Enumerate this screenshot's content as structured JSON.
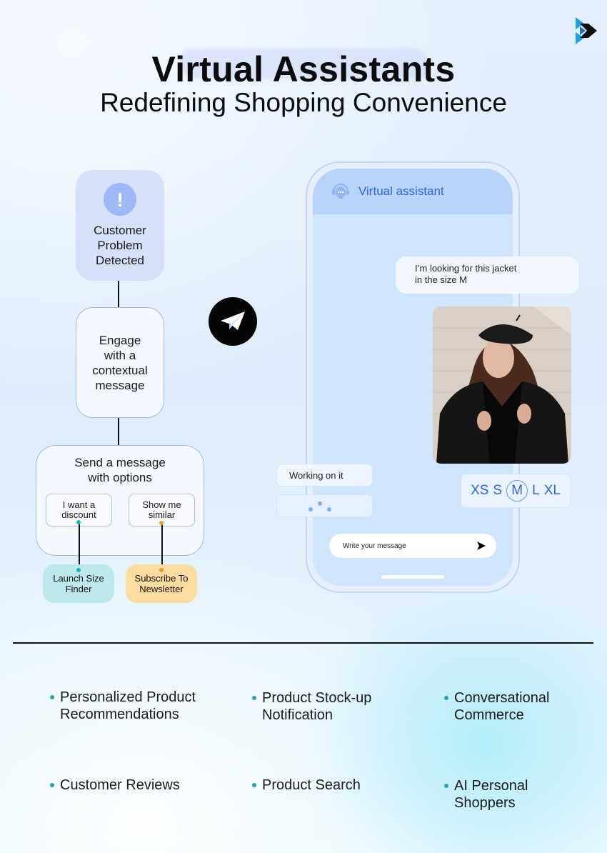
{
  "header": {
    "title": "Virtual Assistants",
    "subtitle": "Redefining Shopping Convenience",
    "logo_icon": "brand-arrow-logo"
  },
  "flow": {
    "problem": {
      "icon": "exclamation-icon",
      "icon_glyph": "!",
      "label": [
        "Customer",
        "Problem",
        "Detected"
      ]
    },
    "engage": {
      "label": [
        "Engage",
        "with a",
        "contextual",
        "message"
      ]
    },
    "send": {
      "label": [
        "Send a message",
        "with options"
      ],
      "options": [
        {
          "label": [
            "I want a",
            "discount"
          ]
        },
        {
          "label": [
            "Show me",
            "similar"
          ]
        }
      ]
    },
    "outcomes": [
      {
        "label": [
          "Launch Size",
          "Finder"
        ],
        "color": "#bde8ec",
        "connector_color": "#17b3c7"
      },
      {
        "label": [
          "Subscribe To",
          "Newsletter"
        ],
        "color": "#fddca0",
        "connector_color": "#f0a01a"
      }
    ]
  },
  "center_icon": "telegram-send-icon",
  "chat": {
    "header_title": "Virtual assistant",
    "header_icon": "headset-chat-icon",
    "user_message": [
      "I’m looking for this jacket",
      "in the size M"
    ],
    "photo_alt": "Woman in black leather jacket and beret",
    "sizes": [
      "XS",
      "S",
      "M",
      "L",
      "XL"
    ],
    "selected_size": "M",
    "bot_message": "Working on it",
    "typing_indicator": "three-dots",
    "input_placeholder": "Write your message",
    "send_icon": "send-arrow-icon"
  },
  "features": [
    [
      "Personalized Product",
      "Recommendations"
    ],
    [
      "Product Stock-up",
      "Notification"
    ],
    [
      "Conversational",
      "Commerce"
    ],
    [
      "Customer Reviews"
    ],
    [
      "Product Search"
    ],
    [
      "AI Personal",
      "Shoppers"
    ]
  ]
}
